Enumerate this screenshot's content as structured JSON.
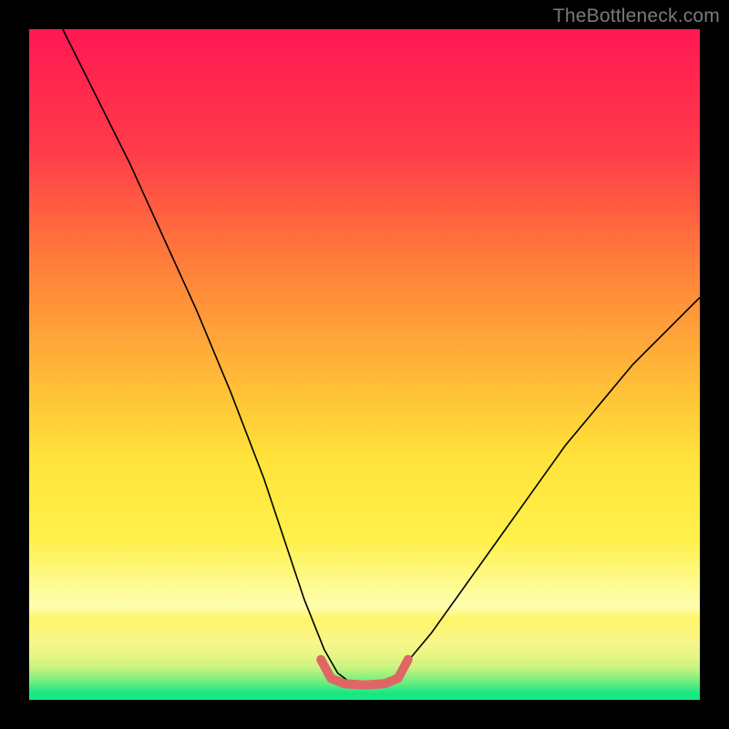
{
  "watermark": "TheBottleneck.com",
  "chart_data": {
    "type": "line",
    "title": "",
    "xlabel": "",
    "ylabel": "",
    "xlim": [
      0,
      100
    ],
    "ylim": [
      0,
      100
    ],
    "series": [
      {
        "name": "bottleneck-curve",
        "stroke": "#000000",
        "stroke_width": 1.6,
        "x": [
          5,
          10,
          15,
          20,
          25,
          30,
          35,
          38,
          41,
          44,
          46,
          48,
          50,
          53,
          55,
          60,
          65,
          70,
          75,
          80,
          85,
          90,
          95,
          100
        ],
        "y": [
          100,
          90,
          80,
          69,
          58,
          46,
          33,
          24,
          15,
          7.5,
          4.0,
          2.5,
          2.3,
          2.5,
          4.0,
          10,
          17,
          24,
          31,
          38,
          44,
          50,
          55,
          60
        ]
      },
      {
        "name": "bottleneck-floor",
        "stroke": "#e06666",
        "stroke_width": 10,
        "linecap": "round",
        "x": [
          43.5,
          45,
          47,
          50,
          53,
          55,
          56.5
        ],
        "y": [
          6.0,
          3.2,
          2.4,
          2.2,
          2.4,
          3.2,
          6.0
        ]
      }
    ],
    "bands": [
      {
        "y": 1.0,
        "color": "#18e884"
      },
      {
        "y": 2.0,
        "color": "#4ceb81"
      },
      {
        "y": 3.0,
        "color": "#7def7e"
      },
      {
        "y": 4.0,
        "color": "#a6f27e"
      },
      {
        "y": 5.0,
        "color": "#cdf481"
      },
      {
        "y": 6.5,
        "color": "#e6f585"
      },
      {
        "y": 8.5,
        "color": "#f7f78a"
      },
      {
        "y": 12,
        "color": "#fef56a"
      }
    ],
    "gradient": {
      "top": "#ff1853",
      "upper_mid": "#ff7a3a",
      "mid": "#ffb337",
      "lower_mid": "#ffe33a",
      "yellow_core": "#fff04a",
      "pale": "#feffb0"
    }
  }
}
